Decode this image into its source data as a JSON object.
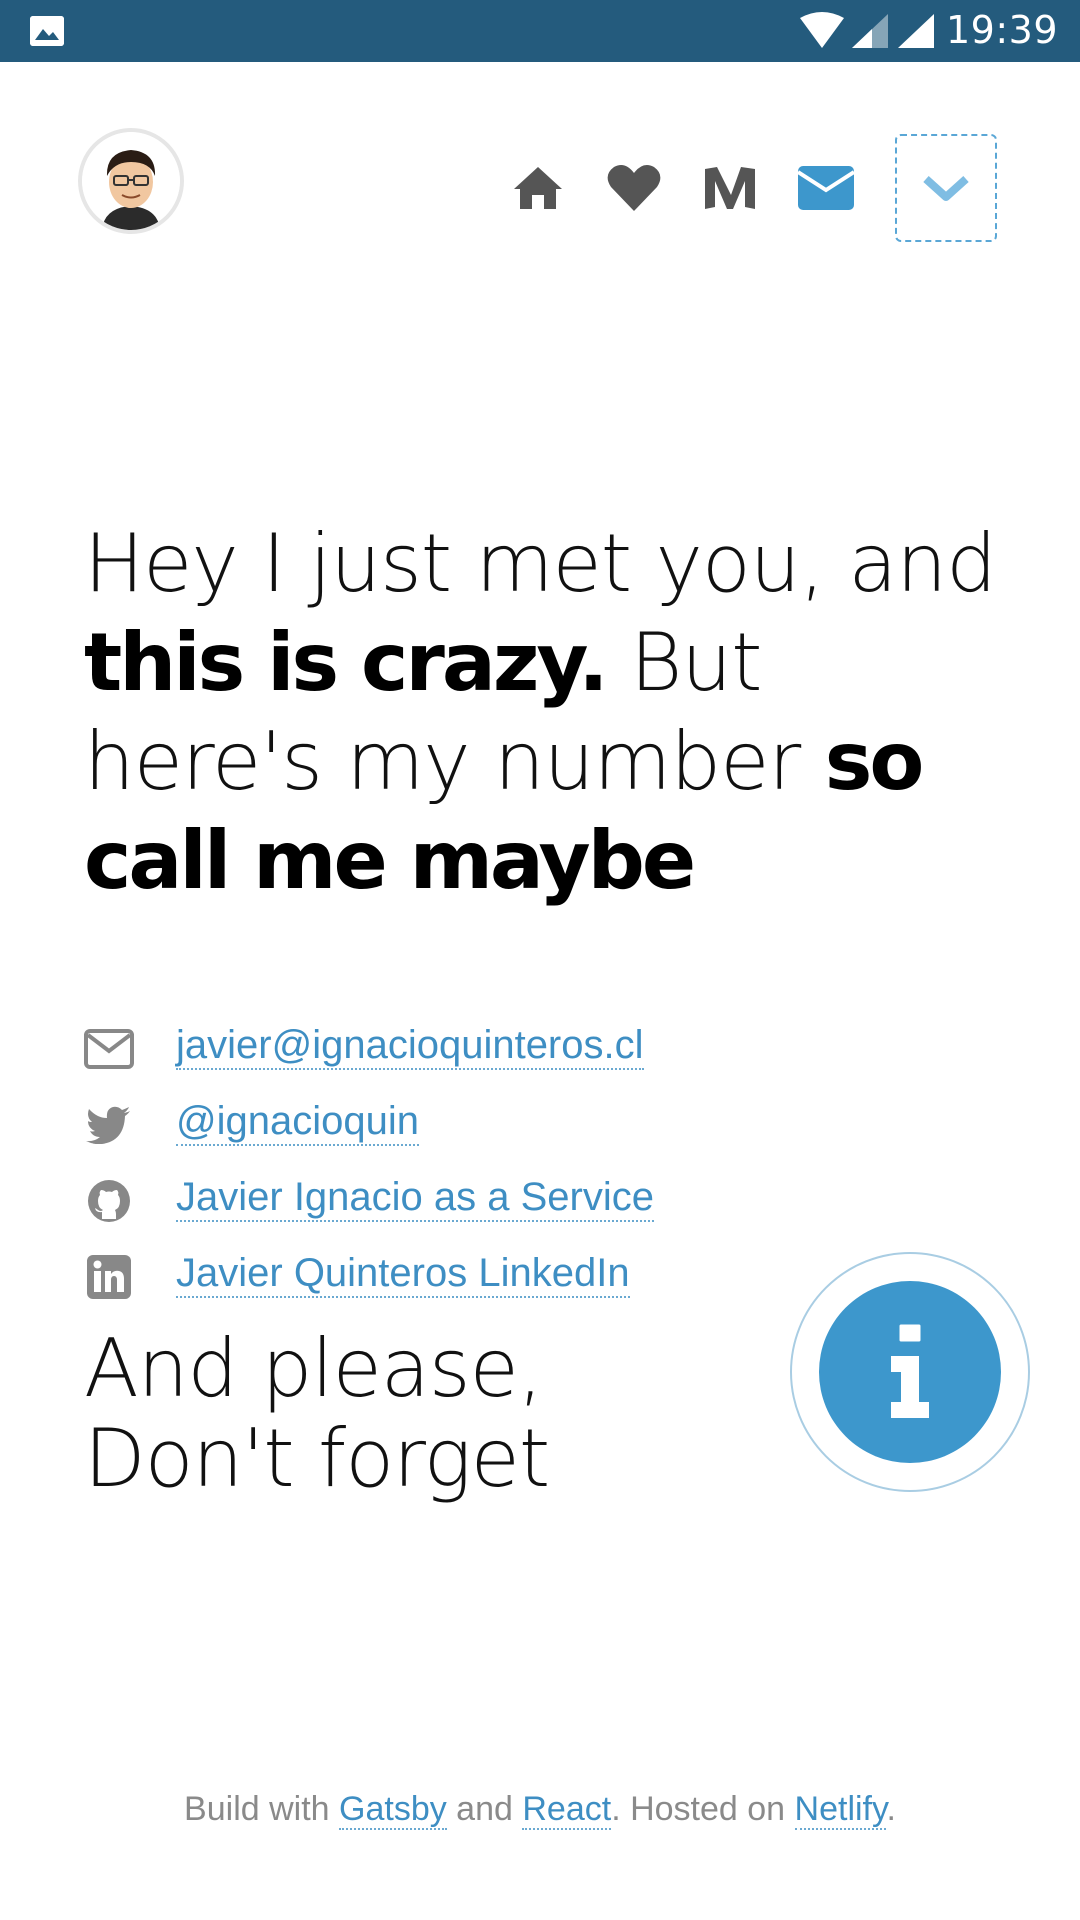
{
  "status_bar": {
    "time": "19:39",
    "icons": [
      "gallery-icon",
      "wifi-icon",
      "signal-icon",
      "signal-icon"
    ]
  },
  "nav": {
    "items": [
      "home-icon",
      "heart-icon",
      "medium-icon",
      "mail-icon"
    ],
    "active": "mail-icon",
    "dropdown_icon": "chevron-down-icon"
  },
  "headline": {
    "part1": "Hey I just met you, and ",
    "bold1": "this is crazy.",
    "part2": " But here's my number ",
    "bold2": "so call me maybe"
  },
  "contacts": [
    {
      "icon": "envelope-outline-icon",
      "label": "javier@ignacioquinteros.cl"
    },
    {
      "icon": "twitter-icon",
      "label": "@ignacioquin"
    },
    {
      "icon": "github-icon",
      "label": "Javier Ignacio as a Service"
    },
    {
      "icon": "linkedin-icon",
      "label": "Javier Quinteros LinkedIn"
    }
  ],
  "reminder": "And please, Don't forget",
  "info_button_icon": "info-icon",
  "footer": {
    "prefix": "Build with ",
    "link1": "Gatsby",
    "and": " and ",
    "link2": "React",
    "hosted": ". Hosted on ",
    "link3": "Netlify",
    "suffix": "."
  },
  "colors": {
    "status_bar": "#245b7d",
    "accent": "#3d97cc",
    "link": "#3e8ec3",
    "icon_gray": "#555555"
  }
}
